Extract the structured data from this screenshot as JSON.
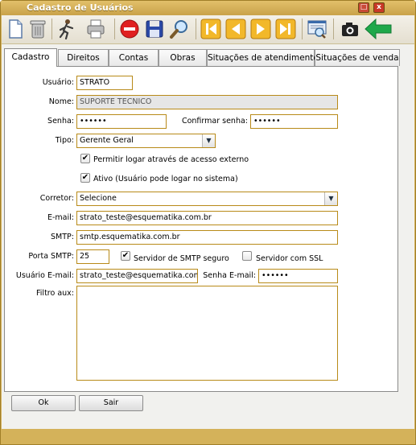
{
  "window": {
    "title": "Cadastro de Usuários",
    "accent": "#d4b25a"
  },
  "toolbar": {
    "icons": [
      "new-document-icon",
      "trash-icon",
      "runner-icon",
      "printer-icon",
      "cancel-icon",
      "save-icon",
      "search-icon",
      "first-record-icon",
      "previous-record-icon",
      "next-record-icon",
      "last-record-icon",
      "report-icon",
      "camera-icon",
      "arrow-left-icon"
    ]
  },
  "tabs": [
    "Cadastro",
    "Direitos",
    "Contas",
    "Obras",
    "Situações de atendimento",
    "Situações de venda"
  ],
  "form": {
    "usuario_label": "Usuário:",
    "usuario_value": "STRATO",
    "nome_label": "Nome:",
    "nome_value": "SUPORTE TECNICO",
    "senha_label": "Senha:",
    "senha_value": "••••••",
    "confirmar_label": "Confirmar senha:",
    "confirmar_value": "••••••",
    "tipo_label": "Tipo:",
    "tipo_value": "Gerente Geral",
    "permitir_label": "Permitir logar através de acesso externo",
    "permitir_checked": true,
    "ativo_label": "Ativo (Usuário pode logar no sistema)",
    "ativo_checked": true,
    "corretor_label": "Corretor:",
    "corretor_value": "Selecione",
    "email_label": "E-mail:",
    "email_value": "strato_teste@esquematika.com.br",
    "smtp_label": "SMTP:",
    "smtp_value": "smtp.esquematika.com.br",
    "porta_label": "Porta SMTP:",
    "porta_value": "25",
    "smtp_seguro_label": "Servidor de SMTP seguro",
    "smtp_seguro_checked": true,
    "ssl_label": "Servidor com SSL",
    "ssl_checked": false,
    "usuario_email_label": "Usuário E-mail:",
    "usuario_email_value": "strato_teste@esquematika.com.br",
    "senha_email_label": "Senha E-mail:",
    "senha_email_value": "••••••",
    "filtro_label": "Filtro aux:",
    "filtro_value": ""
  },
  "buttons": {
    "ok": "Ok",
    "sair": "Sair"
  },
  "check_mark": "✔",
  "dropdown_glyph": "▼",
  "max_glyph": "□",
  "close_glyph": "x"
}
